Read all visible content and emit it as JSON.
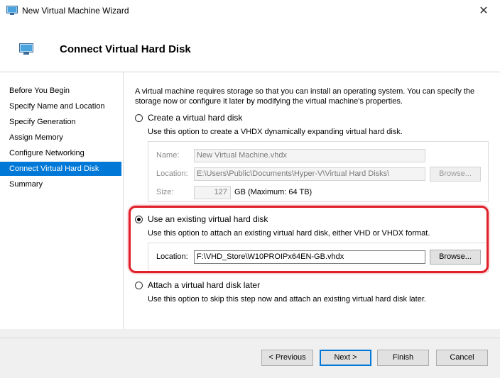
{
  "window": {
    "title": "New Virtual Machine Wizard",
    "close_glyph": "✕"
  },
  "header": {
    "heading": "Connect Virtual Hard Disk"
  },
  "nav": {
    "items": [
      {
        "label": "Before You Begin"
      },
      {
        "label": "Specify Name and Location"
      },
      {
        "label": "Specify Generation"
      },
      {
        "label": "Assign Memory"
      },
      {
        "label": "Configure Networking"
      },
      {
        "label": "Connect Virtual Hard Disk",
        "active": true
      },
      {
        "label": "Summary"
      }
    ]
  },
  "main": {
    "intro": "A virtual machine requires storage so that you can install an operating system. You can specify the storage now or configure it later by modifying the virtual machine's properties.",
    "create_option": {
      "label": "Create a virtual hard disk",
      "description": "Use this option to create a VHDX dynamically expanding virtual hard disk.",
      "selected": false,
      "name_label": "Name:",
      "name_value": "New Virtual Machine.vhdx",
      "location_label": "Location:",
      "location_value": "E:\\Users\\Public\\Documents\\Hyper-V\\Virtual Hard Disks\\",
      "browse_label": "Browse...",
      "size_label": "Size:",
      "size_value": "127",
      "size_unit": "GB (Maximum: 64 TB)"
    },
    "existing_option": {
      "label": "Use an existing virtual hard disk",
      "description": "Use this option to attach an existing virtual hard disk, either VHD or VHDX format.",
      "selected": true,
      "location_label": "Location:",
      "location_value": "F:\\VHD_Store\\W10PROIPx64EN-GB.vhdx",
      "browse_label": "Browse..."
    },
    "later_option": {
      "label": "Attach a virtual hard disk later",
      "description": "Use this option to skip this step now and attach an existing virtual hard disk later.",
      "selected": false
    }
  },
  "footer": {
    "previous_label": "< Previous",
    "next_label": "Next >",
    "finish_label": "Finish",
    "cancel_label": "Cancel"
  },
  "colors": {
    "accent": "#0078d7",
    "highlight": "#e0202a"
  }
}
